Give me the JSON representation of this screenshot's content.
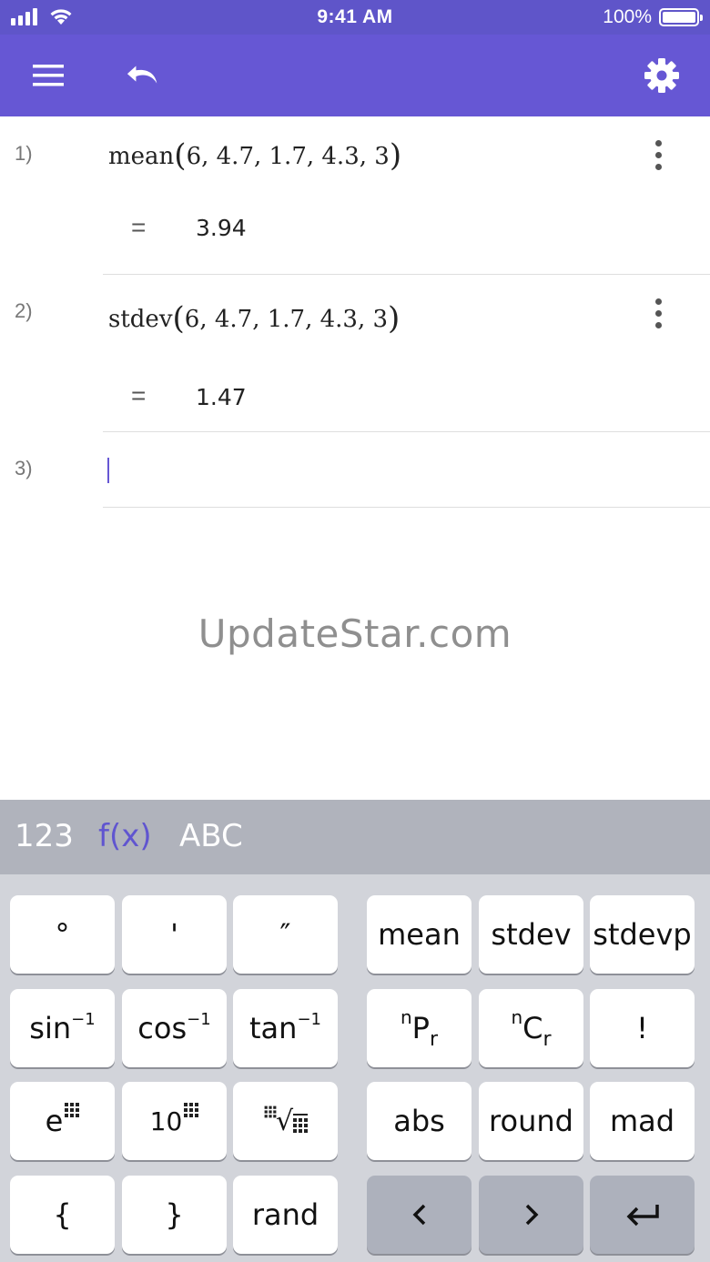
{
  "status_bar": {
    "time": "9:41 AM",
    "battery_percent": "100%"
  },
  "toolbar": {
    "menu_icon": "hamburger-icon",
    "undo_icon": "undo-icon",
    "settings_icon": "gear-icon"
  },
  "expressions": [
    {
      "number": "1)",
      "name": "mean",
      "args": "6, 4.7, 1.7, 4.3, 3",
      "eq": "=",
      "result": "3.94"
    },
    {
      "number": "2)",
      "name": "stdev",
      "args": "6, 4.7, 1.7, 4.3, 3",
      "eq": "=",
      "result": "1.47"
    },
    {
      "number": "3)"
    }
  ],
  "watermark": "UpdateStar.com",
  "keyboard": {
    "tabs": [
      "123",
      "f(x)",
      "ABC"
    ],
    "active_tab": "f(x)",
    "keys": {
      "degree": "°",
      "minute": "'",
      "second": "″",
      "mean": "mean",
      "stdev": "stdev",
      "stdevp": "stdevp",
      "sin_base": "sin",
      "cos_base": "cos",
      "tan_base": "tan",
      "inv_sup": "−1",
      "npr_n": "n",
      "npr_p": "P",
      "npr_r": "r",
      "ncr_n": "n",
      "ncr_c": "C",
      "ncr_r": "r",
      "factorial": "!",
      "exp_base": "e",
      "ten_base": "10",
      "root_symbol": "√",
      "abs": "abs",
      "round": "round",
      "mad": "mad",
      "lbrace": "{",
      "rbrace": "}",
      "rand": "rand",
      "left_icon": "chevron-left-icon",
      "right_icon": "chevron-right-icon",
      "enter_icon": "return-icon"
    }
  }
}
